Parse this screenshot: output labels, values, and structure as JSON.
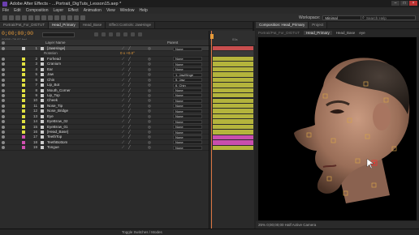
{
  "app": {
    "title": "Adobe After Effects - ...Portrait_DigTuts_Lesson15.aep *",
    "colors": {
      "timecode": "#e59a3a",
      "layer_bar": "#b4b43c",
      "layer_bar_pink": "#c84eae"
    }
  },
  "menu": [
    "File",
    "Edit",
    "Composition",
    "Layer",
    "Effect",
    "Animation",
    "View",
    "Window",
    "Help"
  ],
  "toolbar": {
    "workspace_label": "Workspace:",
    "workspace_value": "Minimal",
    "search_placeholder": "Search Help"
  },
  "left_tabs": [
    {
      "label": "Portrait/Pat_For_DIGTUT"
    },
    {
      "label": "Head_Primary"
    },
    {
      "label": "Head_Base"
    },
    {
      "label": "Effect Controls: JawHinge"
    }
  ],
  "right_tabs": [
    {
      "label": "Composition: Head_Primary"
    },
    {
      "label": "Project"
    }
  ],
  "breadcrumb": [
    "Portrait/Pat_For_DIGTUT",
    "Head_Primary",
    "Head_Base",
    "eye"
  ],
  "timeline": {
    "timecode": "0;00;00;00",
    "frames": "00000 (29.97 fps)",
    "columns": {
      "layer_name": "Layer Name",
      "parent": "Parent"
    },
    "ruler_label": "01s",
    "layers": [
      {
        "num": "1",
        "name": "[JawHinge]",
        "mode": "",
        "parent": "None",
        "label_color": "#d0d0d0",
        "selected": true,
        "bar_color": "#c84e4e"
      },
      {
        "num": "2",
        "name": "Forhead",
        "mode": "",
        "parent": "None",
        "label_color": "#e0e040",
        "selected": false,
        "bar_color": "#b4b43c"
      },
      {
        "num": "3",
        "name": "Cranium",
        "mode": "",
        "parent": "None",
        "label_color": "#e0e040",
        "selected": false,
        "bar_color": "#b4b43c"
      },
      {
        "num": "4",
        "name": "Ear",
        "mode": "",
        "parent": "None",
        "label_color": "#e0e040",
        "selected": false,
        "bar_color": "#b4b43c"
      },
      {
        "num": "5",
        "name": "Jaw",
        "mode": "",
        "parent": "1. JawHinge",
        "label_color": "#e0e040",
        "selected": false,
        "bar_color": "#b4b43c"
      },
      {
        "num": "6",
        "name": "Chin",
        "mode": "",
        "parent": "5. Jaw",
        "label_color": "#e0e040",
        "selected": false,
        "bar_color": "#b4b43c"
      },
      {
        "num": "7",
        "name": "Lip_Bot",
        "mode": "",
        "parent": "6. Chin",
        "label_color": "#e0e040",
        "selected": false,
        "bar_color": "#b4b43c"
      },
      {
        "num": "8",
        "name": "Mouth_Corner",
        "mode": "",
        "parent": "None",
        "label_color": "#e0e040",
        "selected": false,
        "bar_color": "#b4b43c"
      },
      {
        "num": "9",
        "name": "Lip_Top",
        "mode": "",
        "parent": "None",
        "label_color": "#e0e040",
        "selected": false,
        "bar_color": "#b4b43c"
      },
      {
        "num": "10",
        "name": "Cheek",
        "mode": "",
        "parent": "None",
        "label_color": "#e0e040",
        "selected": false,
        "bar_color": "#b4b43c"
      },
      {
        "num": "11",
        "name": "Nose_Tip",
        "mode": "",
        "parent": "None",
        "label_color": "#e0e040",
        "selected": false,
        "bar_color": "#b4b43c"
      },
      {
        "num": "12",
        "name": "Nose_Bridge",
        "mode": "",
        "parent": "None",
        "label_color": "#e0e040",
        "selected": false,
        "bar_color": "#b4b43c"
      },
      {
        "num": "13",
        "name": "Eye",
        "mode": "",
        "parent": "None",
        "label_color": "#e0e040",
        "selected": false,
        "bar_color": "#b4b43c"
      },
      {
        "num": "14",
        "name": "EyeBrow_02",
        "mode": "",
        "parent": "None",
        "label_color": "#e0e040",
        "selected": false,
        "bar_color": "#b4b43c"
      },
      {
        "num": "15",
        "name": "EyeBrow_01",
        "mode": "",
        "parent": "None",
        "label_color": "#e0e040",
        "selected": false,
        "bar_color": "#b4b43c"
      },
      {
        "num": "16",
        "name": "[Head_Base]",
        "mode": "",
        "parent": "None",
        "label_color": "#e0e040",
        "selected": false,
        "bar_color": "#b4b43c"
      },
      {
        "num": "17",
        "name": "TeethTop",
        "mode": "",
        "parent": "None",
        "label_color": "#d050b0",
        "selected": false,
        "bar_color": "#c84eae"
      },
      {
        "num": "18",
        "name": "TeethBottom",
        "mode": "",
        "parent": "None",
        "label_color": "#d050b0",
        "selected": false,
        "bar_color": "#c84eae"
      },
      {
        "num": "19",
        "name": "Tongue",
        "mode": "",
        "parent": "None",
        "label_color": "#d050b0",
        "selected": false,
        "bar_color": "#b4b43c"
      }
    ],
    "rotation": {
      "label": "Rotation",
      "value": "0 x +0.0°"
    },
    "toggle_label": "Toggle Switches / Modes"
  },
  "viewer": {
    "status": "25%   0;00;00;00   Half   Active Camera"
  }
}
